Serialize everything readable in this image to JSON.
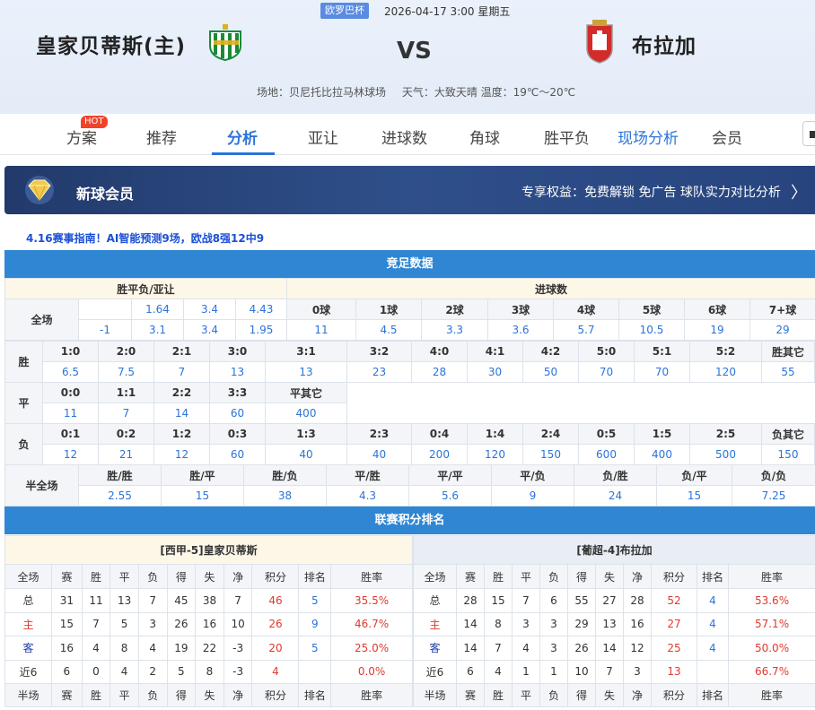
{
  "header": {
    "competition": "欧罗巴杯",
    "datetime": "2026-04-17 3:00 星期五",
    "home": "皇家贝蒂斯(主)",
    "away": "布拉加",
    "vs": "VS",
    "venue": "场地：贝尼托比拉马林球场",
    "weather": "天气：大致天晴  温度：19℃～20℃"
  },
  "tabs": [
    {
      "label": "方案"
    },
    {
      "label": "推荐"
    },
    {
      "label": "分析"
    },
    {
      "label": "亚让"
    },
    {
      "label": "进球数"
    },
    {
      "label": "角球"
    },
    {
      "label": "胜平负"
    },
    {
      "label": "现场分析"
    },
    {
      "label": "会员"
    }
  ],
  "hot_badge": "HOT",
  "banner": {
    "title": "新球会员",
    "benefits": "专享权益：免费解锁 免广告 球队实力对比分析",
    "arrow": "〉"
  },
  "notice": "4.16赛事指南！AI智能预测9场，欧战8强12中9",
  "colors": {
    "accent": "#2b74d9",
    "section": "#2f86d3",
    "red": "#e03a2e"
  },
  "jingzu": {
    "title": "竞足数据",
    "wdl_header": "胜平负/亚让",
    "goals_header": "进球数",
    "full_label": "全场",
    "wdl_row1": [
      "",
      "1.64",
      "3.4",
      "4.43"
    ],
    "wdl_row2": [
      "-1",
      "3.1",
      "3.4",
      "1.95"
    ],
    "goal_labels": [
      "0球",
      "1球",
      "2球",
      "3球",
      "4球",
      "5球",
      "6球",
      "7+球"
    ],
    "goal_odds": [
      "11",
      "4.5",
      "3.3",
      "3.6",
      "5.7",
      "10.5",
      "19",
      "29"
    ],
    "win_label": "胜",
    "draw_label": "平",
    "lose_label": "负",
    "win_scores": [
      "1:0",
      "2:0",
      "2:1",
      "3:0",
      "3:1",
      "3:2",
      "4:0",
      "4:1",
      "4:2",
      "5:0",
      "5:1",
      "5:2",
      "胜其它"
    ],
    "win_odds": [
      "6.5",
      "7.5",
      "7",
      "13",
      "13",
      "23",
      "28",
      "30",
      "50",
      "70",
      "70",
      "120",
      "55"
    ],
    "draw_scores": [
      "0:0",
      "1:1",
      "2:2",
      "3:3",
      "平其它"
    ],
    "draw_odds": [
      "11",
      "7",
      "14",
      "60",
      "400"
    ],
    "lose_scores": [
      "0:1",
      "0:2",
      "1:2",
      "0:3",
      "1:3",
      "2:3",
      "0:4",
      "1:4",
      "2:4",
      "0:5",
      "1:5",
      "2:5",
      "负其它"
    ],
    "lose_odds": [
      "12",
      "21",
      "12",
      "60",
      "40",
      "40",
      "200",
      "120",
      "150",
      "600",
      "400",
      "500",
      "150"
    ],
    "htft_label": "半全场",
    "htft_labels": [
      "胜/胜",
      "胜/平",
      "胜/负",
      "平/胜",
      "平/平",
      "平/负",
      "负/胜",
      "负/平",
      "负/负"
    ],
    "htft_odds": [
      "2.55",
      "15",
      "38",
      "4.3",
      "5.6",
      "9",
      "24",
      "15",
      "7.25"
    ]
  },
  "standings": {
    "title": "联赛积分排名",
    "home_title": "[西甲-5]皇家贝蒂斯",
    "away_title": "[葡超-4]布拉加",
    "columns": [
      "全场",
      "赛",
      "胜",
      "平",
      "负",
      "得",
      "失",
      "净",
      "积分",
      "排名",
      "胜率"
    ],
    "half_columns": [
      "半场",
      "赛",
      "胜",
      "平",
      "负",
      "得",
      "失",
      "净",
      "积分",
      "排名",
      "胜率"
    ],
    "home_rows": [
      [
        "总",
        "31",
        "11",
        "13",
        "7",
        "45",
        "38",
        "7",
        "46",
        "5",
        "35.5%"
      ],
      [
        "主",
        "15",
        "7",
        "5",
        "3",
        "26",
        "16",
        "10",
        "26",
        "9",
        "46.7%"
      ],
      [
        "客",
        "16",
        "4",
        "8",
        "4",
        "19",
        "22",
        "-3",
        "20",
        "5",
        "25.0%"
      ],
      [
        "近6",
        "6",
        "0",
        "4",
        "2",
        "5",
        "8",
        "-3",
        "4",
        "",
        "0.0%"
      ]
    ],
    "away_rows": [
      [
        "总",
        "28",
        "15",
        "7",
        "6",
        "55",
        "27",
        "28",
        "52",
        "4",
        "53.6%"
      ],
      [
        "主",
        "14",
        "8",
        "3",
        "3",
        "29",
        "13",
        "16",
        "27",
        "4",
        "57.1%"
      ],
      [
        "客",
        "14",
        "7",
        "4",
        "3",
        "26",
        "14",
        "12",
        "25",
        "4",
        "50.0%"
      ],
      [
        "近6",
        "6",
        "4",
        "1",
        "1",
        "10",
        "7",
        "3",
        "13",
        "",
        "66.7%"
      ]
    ]
  }
}
